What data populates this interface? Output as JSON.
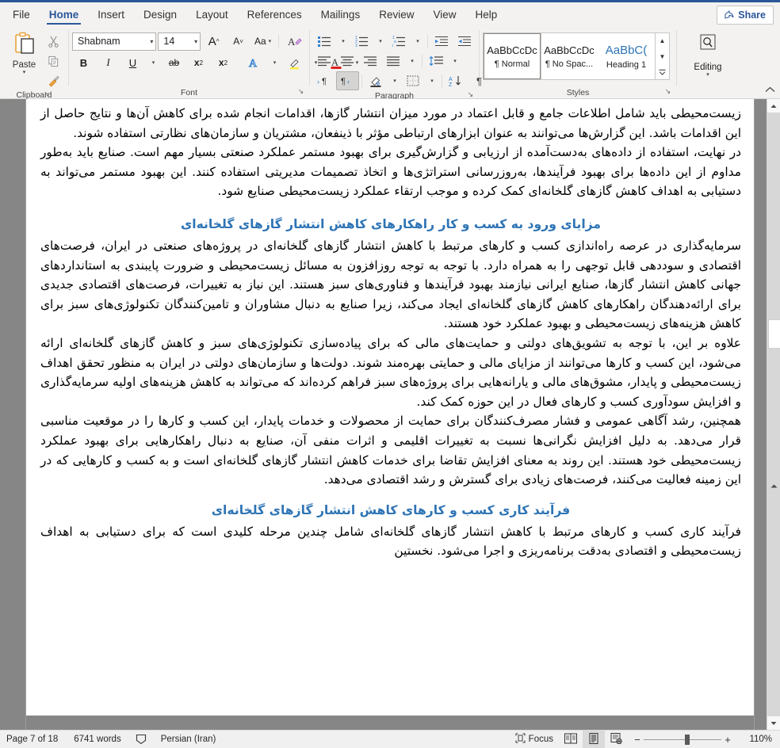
{
  "app": {
    "share_label": "Share",
    "accent": "#2b579a"
  },
  "tabs": [
    {
      "label": "File",
      "active": false
    },
    {
      "label": "Home",
      "active": true
    },
    {
      "label": "Insert",
      "active": false
    },
    {
      "label": "Design",
      "active": false
    },
    {
      "label": "Layout",
      "active": false
    },
    {
      "label": "References",
      "active": false
    },
    {
      "label": "Mailings",
      "active": false
    },
    {
      "label": "Review",
      "active": false
    },
    {
      "label": "View",
      "active": false
    },
    {
      "label": "Help",
      "active": false
    }
  ],
  "ribbon": {
    "clipboard": {
      "title": "Clipboard",
      "paste_label": "Paste",
      "cut_name": "cut-icon",
      "copy_name": "copy-icon",
      "format_painter_name": "format-painter-icon",
      "dialog_launcher": "↘"
    },
    "font": {
      "title": "Font",
      "font_name": "Shabnam",
      "font_size": "14",
      "grow_font": "A",
      "shrink_font": "A",
      "change_case": "Aa",
      "clear_formatting": "A",
      "bold": "B",
      "italic": "I",
      "underline": "U",
      "strikethrough": "ab",
      "subscript": "x",
      "superscript": "x",
      "text_effects": "A",
      "highlight": "A",
      "font_color": "A",
      "dialog_launcher": "↘"
    },
    "paragraph": {
      "title": "Paragraph",
      "bullets": "bullet-list",
      "numbering": "numbered-list",
      "multilevel": "multilevel-list",
      "decrease_indent": "decrease-indent",
      "increase_indent": "increase-indent",
      "align_left": "align-left",
      "align_center": "align-center",
      "align_right": "align-right",
      "justify": "justify",
      "line_spacing": "line-spacing",
      "ltr": "ltr-text-direction",
      "rtl": "rtl-text-direction",
      "shading": "shading",
      "borders": "borders",
      "sort": "sort",
      "show_marks": "¶",
      "dialog_launcher": "↘",
      "rtl_pressed": true
    },
    "styles": {
      "title": "Styles",
      "dialog_launcher": "↘",
      "items": [
        {
          "preview": "AaBbCcDc",
          "label": "¶ Normal",
          "selected": true,
          "heading": false
        },
        {
          "preview": "AaBbCcDc",
          "label": "¶ No Spac...",
          "selected": false,
          "heading": false
        },
        {
          "preview": "AaBbC(",
          "label": "Heading 1",
          "selected": false,
          "heading": true
        }
      ],
      "scroll_up": "▲",
      "scroll_down": "▼",
      "more": "▾"
    },
    "editing": {
      "title": "",
      "label": "Editing",
      "icon": "search-icon"
    },
    "collapse_icon": "chevron-up-icon"
  },
  "document": {
    "blocks": [
      {
        "type": "paragraph",
        "text": "زیست‌محیطی باید شامل اطلاعات جامع و قابل اعتماد در مورد میزان انتشار گازها، اقدامات انجام شده برای کاهش آن‌ها و نتایج حاصل از این اقدامات باشد. این گزارش‌ها می‌توانند به عنوان ابزارهای ارتباطی مؤثر با ذینفعان، مشتریان و سازمان‌های نظارتی استفاده شوند."
      },
      {
        "type": "paragraph",
        "text": "در نهایت، استفاده از داده‌های به‌دست‌آمده از ارزیابی و گزارش‌گیری برای بهبود مستمر عملکرد صنعتی بسیار مهم است. صنایع باید به‌طور مداوم از این داده‌ها برای بهبود فرآیندها، به‌روزرسانی استراتژی‌ها و اتخاذ تصمیمات مدیریتی استفاده کنند. این بهبود مستمر می‌تواند به دستیابی به اهداف کاهش گازهای گلخانه‌ای کمک کرده و موجب ارتقاء عملکرد زیست‌محیطی صنایع شود."
      },
      {
        "type": "heading",
        "text": "مزایای ورود به کسب و کار راهکارهای کاهش انتشار گازهای گلخانه‌ای"
      },
      {
        "type": "paragraph",
        "text": "سرمایه‌گذاری در عرصه راه‌اندازی کسب و کارهای مرتبط با کاهش انتشار گازهای گلخانه‌ای در پروژه‌های صنعتی در ایران، فرصت‌های اقتصادی و سوددهی قابل توجهی را به همراه دارد. با توجه به توجه روزافزون به مسائل زیست‌محیطی و ضرورت پایبندی به استانداردهای جهانی کاهش انتشار گازها، صنایع ایرانی نیازمند بهبود فرآیندها و فناوری‌های سبز هستند. این نیاز به تغییرات، فرصت‌های اقتصادی جدیدی برای ارائه‌دهندگان راهکارهای کاهش گازهای گلخانه‌ای ایجاد می‌کند، زیرا صنایع به دنبال مشاوران و تامین‌کنندگان تکنولوژی‌های سبز برای کاهش هزینه‌های زیست‌محیطی و بهبود عملکرد خود هستند."
      },
      {
        "type": "paragraph",
        "text": "علاوه بر این، با توجه به تشویق‌های دولتی و حمایت‌های مالی که برای پیاده‌سازی تکنولوژی‌های سبز و کاهش گازهای گلخانه‌ای ارائه می‌شود، این کسب و کارها می‌توانند از مزایای مالی و حمایتی بهره‌مند شوند. دولت‌ها و سازمان‌های دولتی در ایران به منظور تحقق اهداف زیست‌محیطی و پایدار، مشوق‌های مالی و یارانه‌هایی برای پروژه‌های سبز فراهم کرده‌اند که می‌تواند به کاهش هزینه‌های اولیه سرمایه‌گذاری و افزایش سودآوری کسب و کارهای فعال در این حوزه کمک کند."
      },
      {
        "type": "paragraph",
        "text": "همچنین، رشد آگاهی عمومی و فشار مصرف‌کنندگان برای حمایت از محصولات و خدمات پایدار، این کسب و کارها را در موقعیت مناسبی قرار می‌دهد. به دلیل افزایش نگرانی‌ها نسبت به تغییرات اقلیمی و اثرات منفی آن، صنایع به دنبال راهکارهایی برای بهبود عملکرد زیست‌محیطی خود هستند. این روند به معنای افزایش تقاضا برای خدمات کاهش انتشار گازهای گلخانه‌ای است و به کسب و کارهایی که در این زمینه فعالیت می‌کنند، فرصت‌های زیادی برای گسترش و رشد اقتصادی می‌دهد."
      },
      {
        "type": "heading",
        "text": "فرآیند کاری کسب و کارهای کاهش انتشار گازهای گلخانه‌ای"
      },
      {
        "type": "paragraph",
        "text": "فرآیند کاری کسب و کارهای مرتبط با کاهش انتشار گازهای گلخانه‌ای شامل چندین مرحله کلیدی است که برای دستیابی به اهداف زیست‌محیطی و اقتصادی به‌دقت برنامه‌ریزی و اجرا می‌شود. نخستین"
      }
    ],
    "heading_color": "#2e74b5"
  },
  "status": {
    "page": "Page 7 of 18",
    "words": "6741 words",
    "proofing_icon": "proofing-errors-icon",
    "language": "Persian (Iran)",
    "focus_label": "Focus",
    "focus_icon": "focus-mode-icon",
    "read_mode_icon": "read-mode-icon",
    "print_layout_icon": "print-layout-icon",
    "web_layout_icon": "web-layout-icon",
    "zoom_out": "−",
    "zoom_in": "+",
    "zoom_value": "110%"
  },
  "scrollbar": {
    "up_arrow": "▲",
    "down_arrow": "▼",
    "prev_page": "▲",
    "next_page": "▼"
  }
}
